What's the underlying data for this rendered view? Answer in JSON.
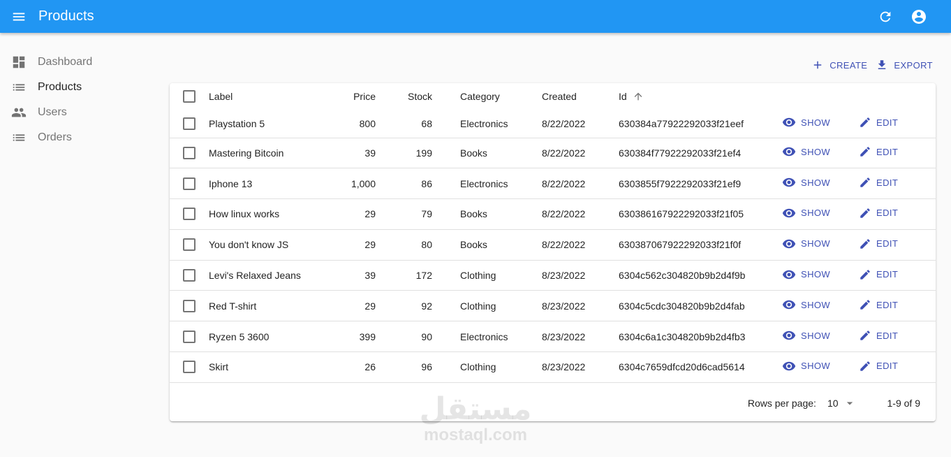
{
  "appbar": {
    "title": "Products",
    "menu_icon": "menu-icon",
    "refresh_icon": "refresh-icon",
    "account_icon": "account-icon"
  },
  "sidebar": {
    "items": [
      {
        "label": "Dashboard",
        "icon": "dashboard-icon",
        "active": false
      },
      {
        "label": "Products",
        "icon": "list-icon",
        "active": true
      },
      {
        "label": "Users",
        "icon": "people-icon",
        "active": false
      },
      {
        "label": "Orders",
        "icon": "list-icon",
        "active": false
      }
    ]
  },
  "actions": {
    "create_label": "CREATE",
    "export_label": "EXPORT"
  },
  "table": {
    "headers": {
      "label": "Label",
      "price": "Price",
      "stock": "Stock",
      "category": "Category",
      "created": "Created",
      "id": "Id"
    },
    "show_label": "SHOW",
    "edit_label": "EDIT",
    "rows": [
      {
        "label": "Playstation 5",
        "price": "800",
        "stock": "68",
        "category": "Electronics",
        "created": "8/22/2022",
        "id": "630384a77922292033f21eef"
      },
      {
        "label": "Mastering Bitcoin",
        "price": "39",
        "stock": "199",
        "category": "Books",
        "created": "8/22/2022",
        "id": "630384f77922292033f21ef4"
      },
      {
        "label": "Iphone 13",
        "price": "1,000",
        "stock": "86",
        "category": "Electronics",
        "created": "8/22/2022",
        "id": "6303855f7922292033f21ef9"
      },
      {
        "label": "How linux works",
        "price": "29",
        "stock": "79",
        "category": "Books",
        "created": "8/22/2022",
        "id": "630386167922292033f21f05"
      },
      {
        "label": "You don't know JS",
        "price": "29",
        "stock": "80",
        "category": "Books",
        "created": "8/22/2022",
        "id": "630387067922292033f21f0f"
      },
      {
        "label": "Levi's Relaxed Jeans",
        "price": "39",
        "stock": "172",
        "category": "Clothing",
        "created": "8/23/2022",
        "id": "6304c562c304820b9b2d4f9b"
      },
      {
        "label": "Red T-shirt",
        "price": "29",
        "stock": "92",
        "category": "Clothing",
        "created": "8/23/2022",
        "id": "6304c5cdc304820b9b2d4fab"
      },
      {
        "label": "Ryzen 5 3600",
        "price": "399",
        "stock": "90",
        "category": "Electronics",
        "created": "8/23/2022",
        "id": "6304c6a1c304820b9b2d4fb3"
      },
      {
        "label": "Skirt",
        "price": "26",
        "stock": "96",
        "category": "Clothing",
        "created": "8/23/2022",
        "id": "6304c7659dfcd20d6cad5614"
      }
    ]
  },
  "pagination": {
    "rows_per_page_label": "Rows per page:",
    "rows_per_page_value": "10",
    "range": "1-9 of 9"
  },
  "watermark": {
    "arabic": "مستقل",
    "latin": "mostaql.com"
  },
  "colors": {
    "appbar": "#2196f3",
    "primary": "#3f51b5",
    "background": "#fafafa"
  }
}
